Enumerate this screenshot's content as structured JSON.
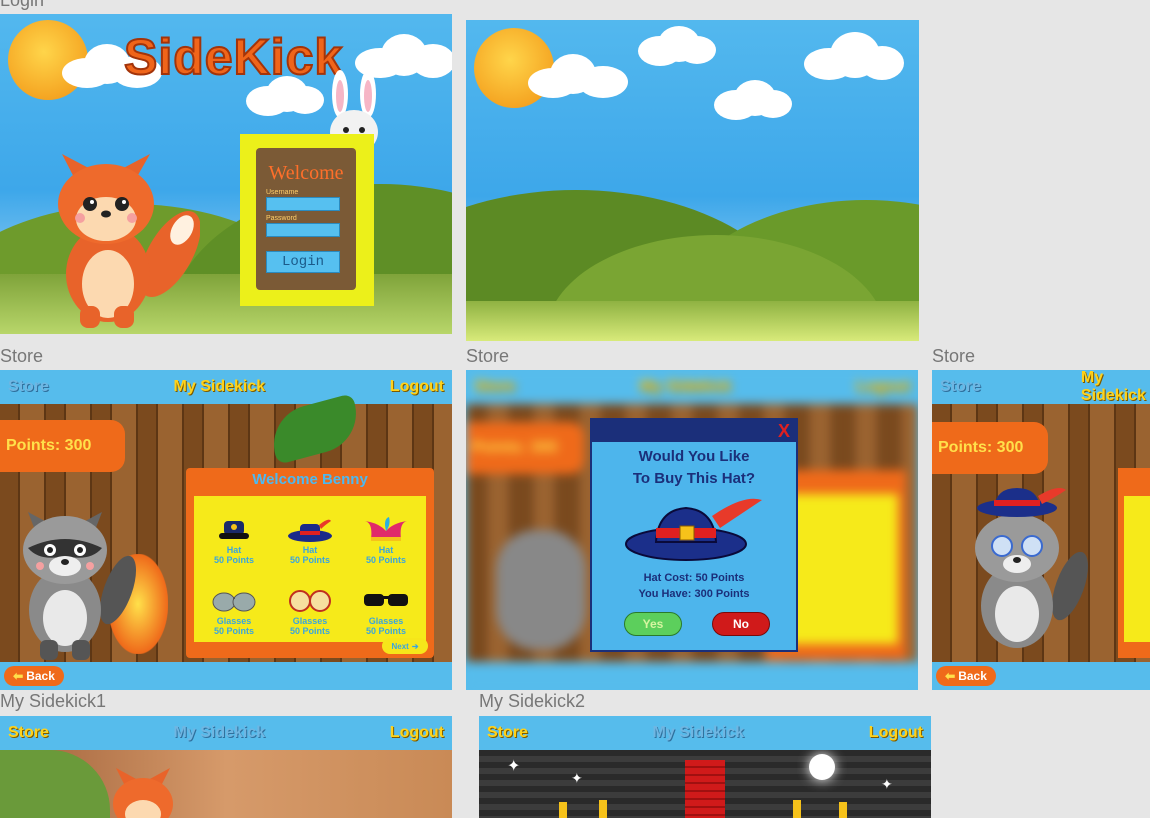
{
  "labels": {
    "login": "Login",
    "store_1": "Store",
    "store_2": "Store",
    "store_3": "Store",
    "my_sidekick_1": "My Sidekick1",
    "my_sidekick_2": "My Sidekick2"
  },
  "login": {
    "logo": "SideKick",
    "welcome": "Welcome",
    "username_label": "Username",
    "password_label": "Password",
    "login_button": "Login"
  },
  "nav": {
    "store": "Store",
    "my_sidekick": "My Sidekick",
    "logout": "Logout"
  },
  "store": {
    "points": "Points: 300",
    "welcome": "Welcome Benny",
    "back": "Back",
    "next": "Next",
    "items": [
      {
        "name": "Hat",
        "cost": "50 Points",
        "icon": "police-hat-icon"
      },
      {
        "name": "Hat",
        "cost": "50 Points",
        "icon": "feather-hat-icon"
      },
      {
        "name": "Hat",
        "cost": "50 Points",
        "icon": "jester-hat-icon"
      },
      {
        "name": "Glasses",
        "cost": "50 Points",
        "icon": "aviator-glasses-icon"
      },
      {
        "name": "Glasses",
        "cost": "50 Points",
        "icon": "round-glasses-icon"
      },
      {
        "name": "Glasses",
        "cost": "50 Points",
        "icon": "sunglasses-icon"
      }
    ]
  },
  "dialog": {
    "close": "X",
    "question_line1": "Would You Like",
    "question_line2": "To Buy This Hat?",
    "cost": "Hat Cost: 50 Points",
    "have": "You Have: 300 Points",
    "yes": "Yes",
    "no": "No"
  },
  "colors": {
    "accent_blue": "#56bcec",
    "accent_yellow": "#ffd21a",
    "accent_orange": "#ef6a1a",
    "yes_green": "#5ccf5c",
    "no_red": "#d01a1a"
  }
}
